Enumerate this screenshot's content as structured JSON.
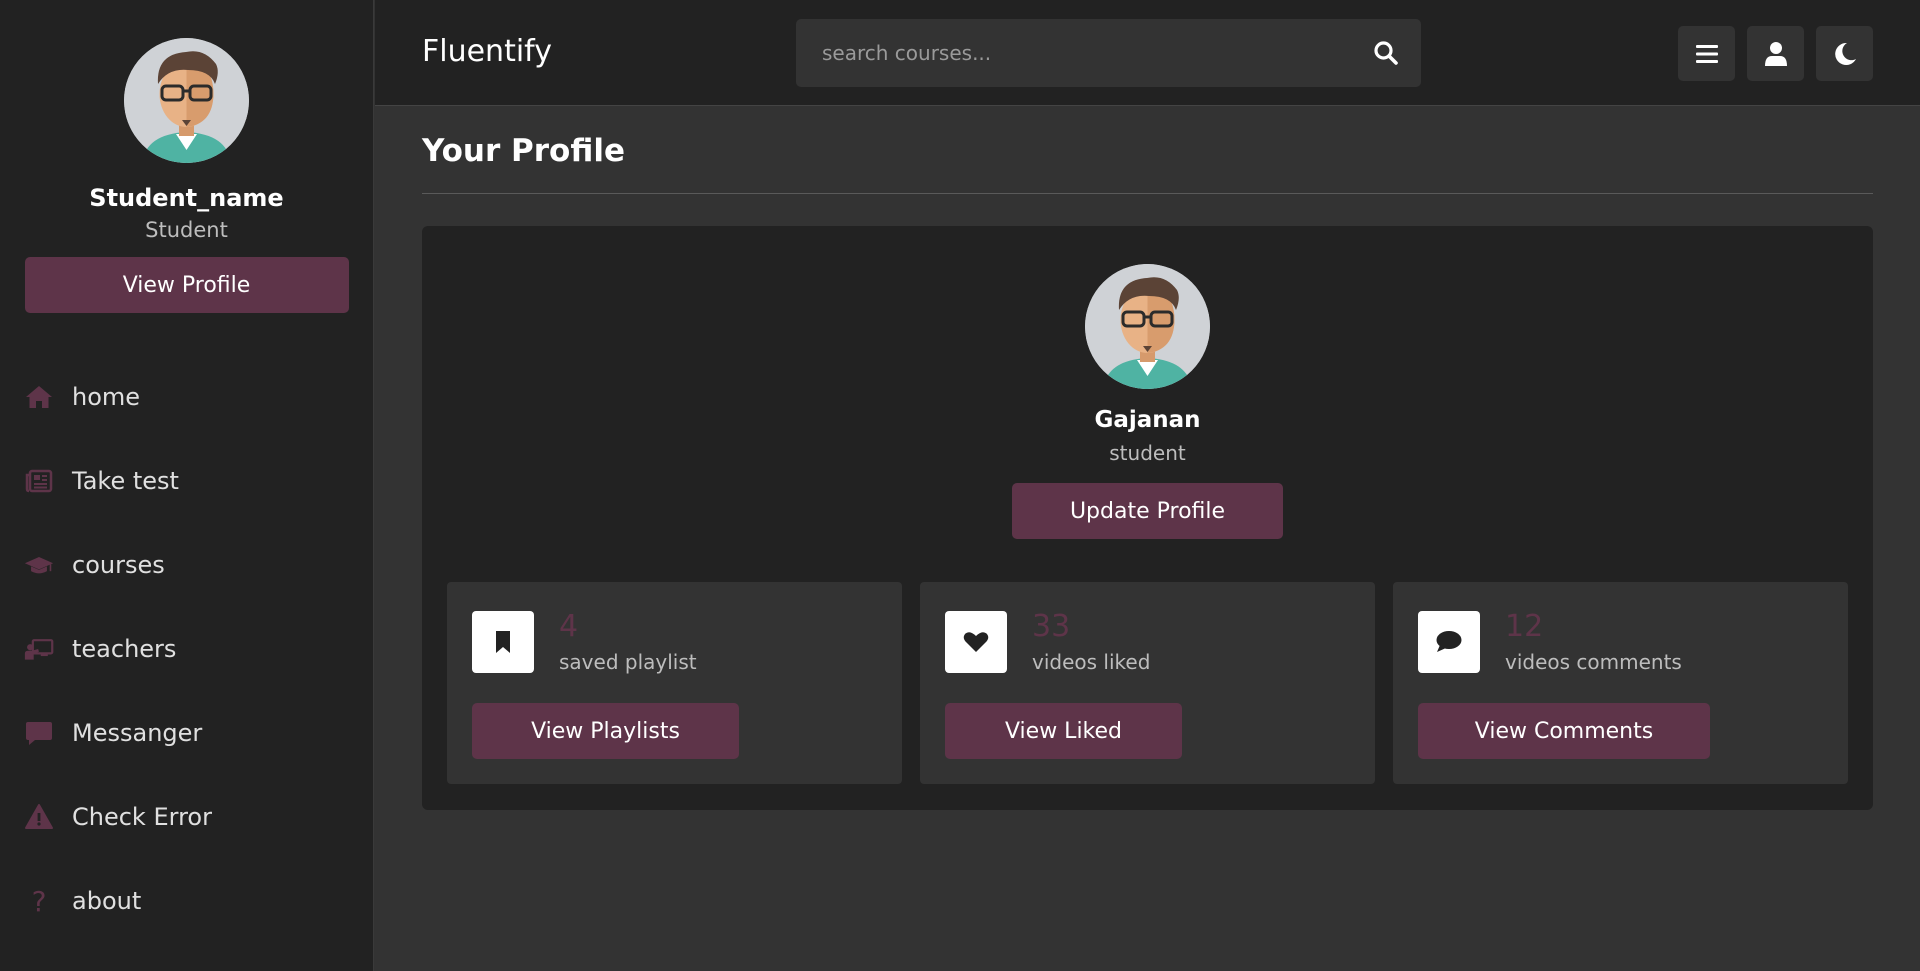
{
  "sidebar": {
    "user_name": "Student_name",
    "user_role": "Student",
    "view_profile_label": "View Profile",
    "nav": [
      {
        "label": "home",
        "icon": "home-icon"
      },
      {
        "label": "Take test",
        "icon": "newspaper-icon"
      },
      {
        "label": "courses",
        "icon": "graduation-cap-icon"
      },
      {
        "label": "teachers",
        "icon": "chalkboard-teacher-icon"
      },
      {
        "label": "Messanger",
        "icon": "message-icon"
      },
      {
        "label": "Check Error",
        "icon": "warning-icon"
      },
      {
        "label": "about",
        "icon": "question-icon",
        "glyph": "?"
      }
    ]
  },
  "header": {
    "brand": "Fluentify",
    "search_placeholder": "search courses...",
    "icons": [
      "search-icon",
      "menu-icon",
      "user-icon",
      "moon-icon"
    ]
  },
  "main": {
    "title": "Your Profile",
    "profile": {
      "name": "Gajanan",
      "role": "student",
      "update_label": "Update Profile"
    },
    "cards": [
      {
        "count": "4",
        "label": "saved playlist",
        "button": "View Playlists",
        "icon": "bookmark-icon"
      },
      {
        "count": "33",
        "label": "videos liked",
        "button": "View Liked",
        "icon": "heart-icon"
      },
      {
        "count": "12",
        "label": "videos comments",
        "button": "View Comments",
        "icon": "comment-icon"
      }
    ]
  },
  "colors": {
    "accent": "#5e3449",
    "sidebar_bg": "#222222",
    "main_bg": "#333333",
    "panel_bg": "#222222"
  }
}
